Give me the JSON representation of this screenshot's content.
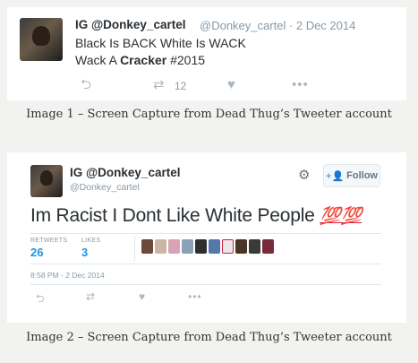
{
  "tweet1": {
    "display_name": "IG @Donkey_cartel",
    "handle_and_date": "@Donkey_cartel · 2 Dec 2014",
    "line1": "Black Is BACK White Is WACK",
    "line2_prefix": "Wack A ",
    "line2_bold": "Cracker",
    "line2_suffix": " #2015",
    "retweet_count": "12"
  },
  "caption1": "Image 1 – Screen Capture from Dead Thug’s Tweeter account",
  "tweet2": {
    "display_name": "IG @Donkey_cartel",
    "handle": "@Donkey_cartel",
    "follow_label": "Follow",
    "text": "Im Racist I Dont Like White People ",
    "emoji_text": "💯💯",
    "retweets_label": "RETWEETS",
    "retweets_count": "26",
    "likes_label": "LIKES",
    "likes_count": "3",
    "timestamp": "8:58 PM - 2 Dec 2014"
  },
  "caption2": "Image 2 – Screen Capture from Dead Thug’s Tweeter account",
  "icons": {
    "reply": "reply-icon",
    "retweet": "retweet-icon",
    "like": "heart-icon",
    "more": "more-icon",
    "settings": "gear-icon",
    "follow": "add-user-icon"
  },
  "colors": {
    "link_blue": "#1b95e0",
    "muted": "#8899a6",
    "emoji_red": "#d9213f"
  }
}
